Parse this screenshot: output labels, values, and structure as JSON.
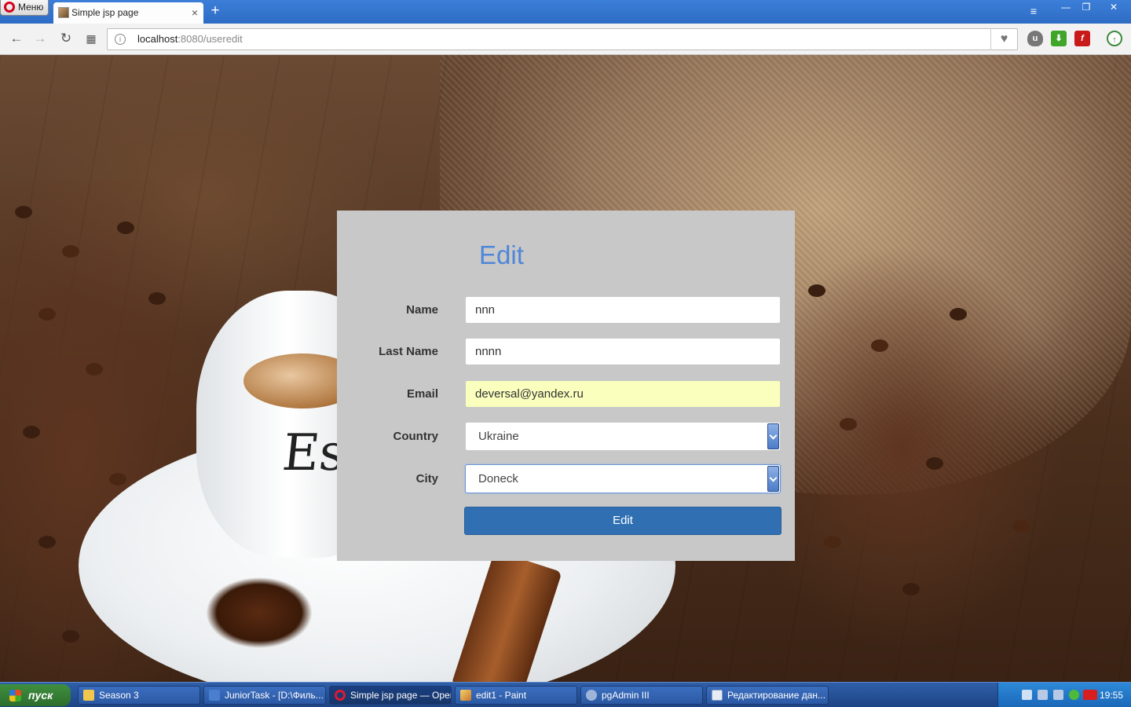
{
  "browser": {
    "menu_label": "Меню",
    "tab_title": "Simple jsp page",
    "new_tab_symbol": "+",
    "close_symbol": "×",
    "url_host": "localhost",
    "url_path": ":8080/useredit"
  },
  "form": {
    "title": "Edit",
    "fields": [
      {
        "label": "Name",
        "value": "nnn"
      },
      {
        "label": "Last Name",
        "value": "nnnn"
      },
      {
        "label": "Email",
        "value": "deversal@yandex.ru"
      }
    ],
    "country": {
      "label": "Country",
      "value": "Ukraine"
    },
    "city": {
      "label": "City",
      "value": "Doneck"
    },
    "submit_label": "Edit"
  },
  "background": {
    "cup_text": "Es"
  },
  "taskbar": {
    "start_label": "пуск",
    "tasks": [
      "Season 3",
      "JuniorTask - [D:\\Филь...",
      "Simple jsp page — Opera",
      "edit1 - Paint",
      "pgAdmin III",
      "Редактирование дан..."
    ],
    "clock": "19:55"
  },
  "colors": {
    "title_blue": "#4f86d8",
    "button_blue": "#2f6fb2",
    "card_gray": "#c8c8c8",
    "autofill_yellow": "#faffbd"
  }
}
